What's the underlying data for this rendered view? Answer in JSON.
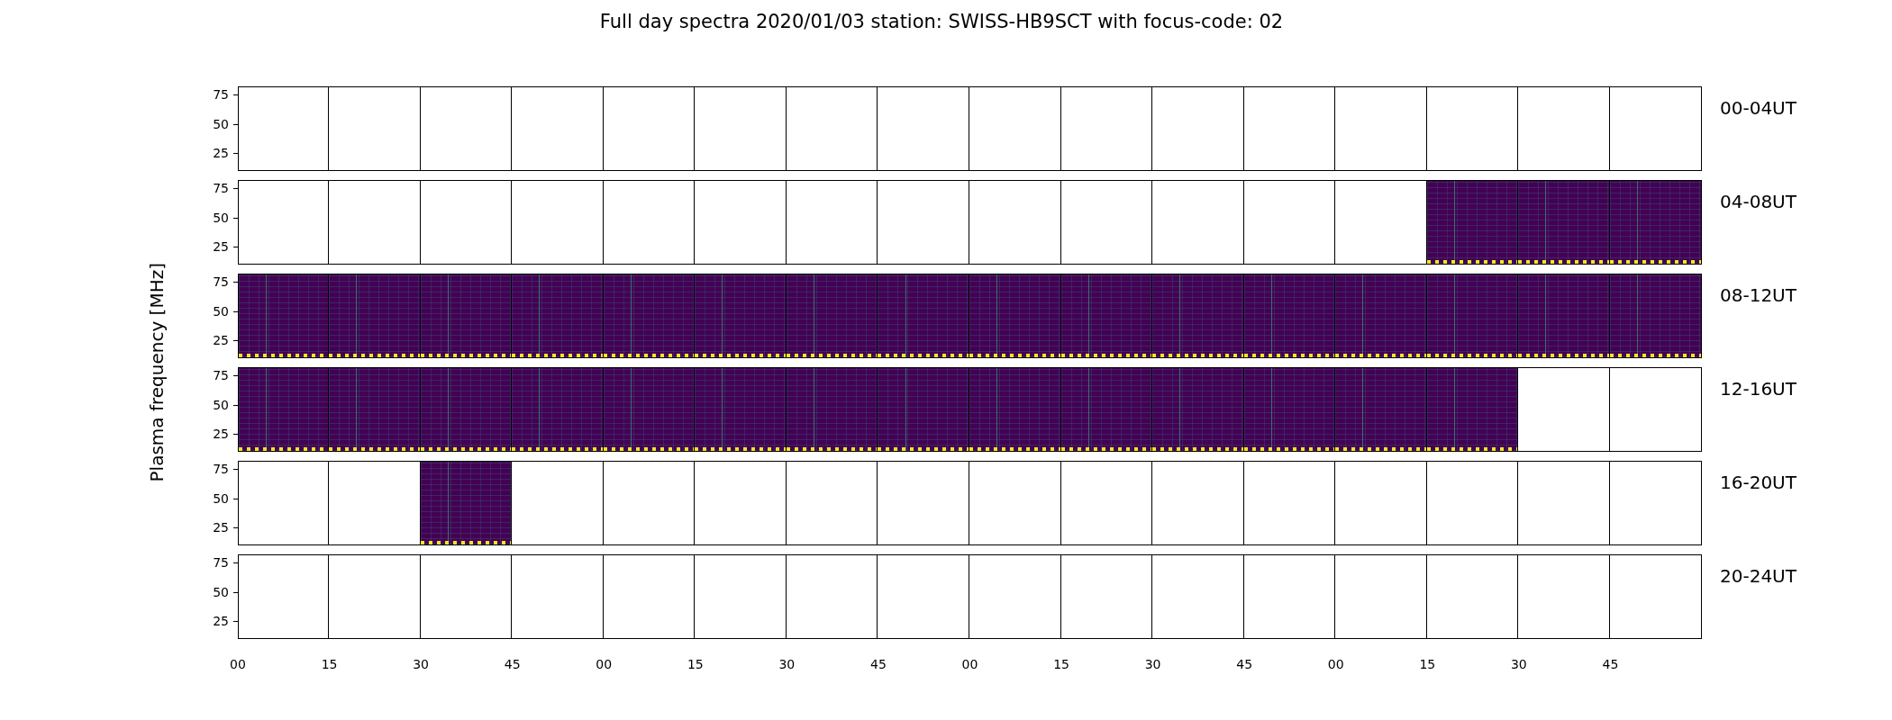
{
  "title": "Full day spectra 2020/01/03 station: SWISS-HB9SCT with focus-code: 02",
  "y_axis_label": "Plasma frequency [MHz]",
  "rows": [
    {
      "label": "00-04UT",
      "y_ticks": [
        "75",
        "50",
        "25"
      ],
      "data_shown": [
        false,
        false,
        false,
        false,
        false,
        false,
        false,
        false,
        false,
        false,
        false,
        false,
        false,
        false,
        false,
        false
      ]
    },
    {
      "label": "04-08UT",
      "y_ticks": [
        "75",
        "50",
        "25"
      ],
      "data_shown": [
        false,
        false,
        false,
        false,
        false,
        false,
        false,
        false,
        false,
        false,
        false,
        false,
        false,
        true,
        true,
        true
      ]
    },
    {
      "label": "08-12UT",
      "y_ticks": [
        "75",
        "50",
        "25"
      ],
      "data_shown": [
        true,
        true,
        true,
        true,
        true,
        true,
        true,
        true,
        true,
        true,
        true,
        true,
        true,
        true,
        true,
        true
      ]
    },
    {
      "label": "12-16UT",
      "y_ticks": [
        "75",
        "50",
        "25"
      ],
      "data_shown": [
        true,
        true,
        true,
        true,
        true,
        true,
        true,
        true,
        true,
        true,
        true,
        true,
        true,
        true,
        false,
        false
      ]
    },
    {
      "label": "16-20UT",
      "y_ticks": [
        "75",
        "50",
        "25"
      ],
      "data_shown": [
        false,
        false,
        true,
        false,
        false,
        false,
        false,
        false,
        false,
        false,
        false,
        false,
        false,
        false,
        false,
        false
      ]
    },
    {
      "label": "20-24UT",
      "y_ticks": [
        "75",
        "50",
        "25"
      ],
      "data_shown": [
        false,
        false,
        false,
        false,
        false,
        false,
        false,
        false,
        false,
        false,
        false,
        false,
        false,
        false,
        false,
        false
      ]
    }
  ],
  "x_ticks": [
    "00",
    "15",
    "30",
    "45",
    "00",
    "15",
    "30",
    "45",
    "00",
    "15",
    "30",
    "45",
    "00",
    "15",
    "30",
    "45"
  ]
}
